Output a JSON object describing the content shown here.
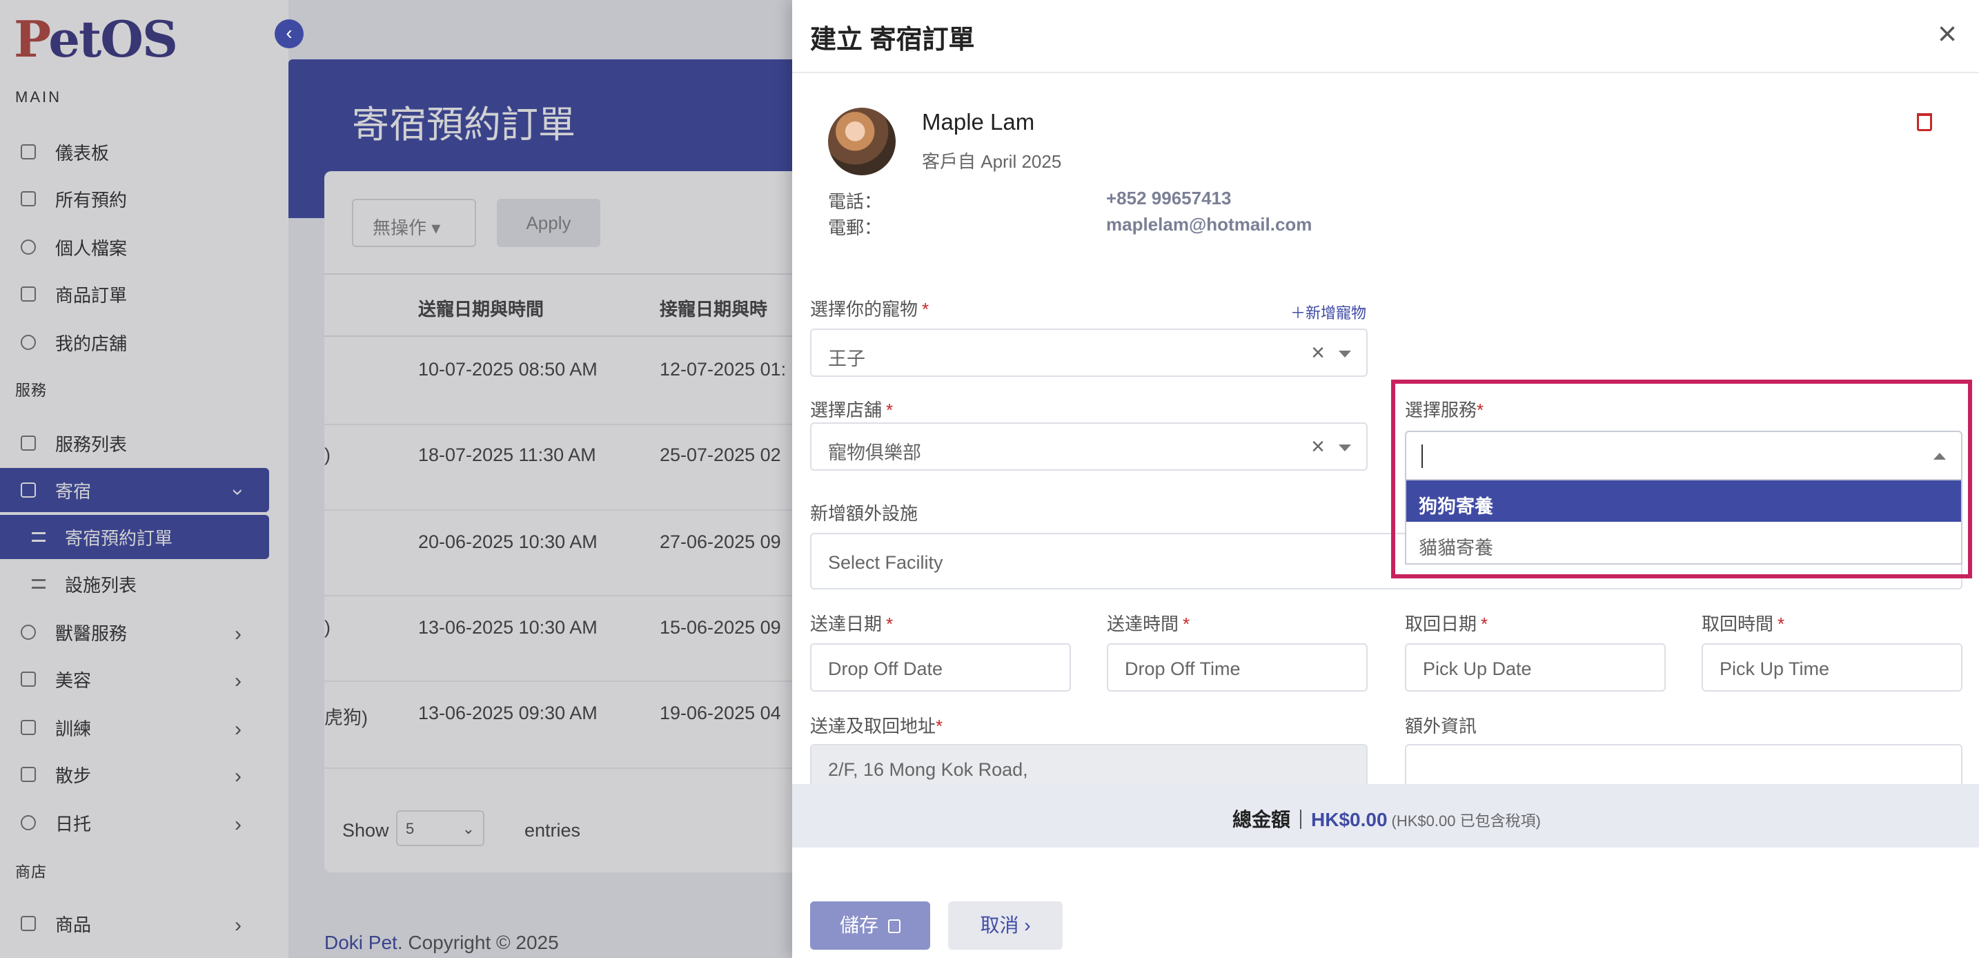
{
  "sidebar": {
    "logo": "PetOS",
    "sections": {
      "main": "MAIN",
      "services": "服務",
      "shop": "商店"
    },
    "items": [
      {
        "label": "儀表板"
      },
      {
        "label": "所有預約"
      },
      {
        "label": "個人檔案"
      },
      {
        "label": "商品訂單"
      },
      {
        "label": "我的店舖"
      },
      {
        "label": "服務列表"
      },
      {
        "label": "寄宿",
        "expanded": true
      },
      {
        "label": "寄宿預約訂單",
        "active": true
      },
      {
        "label": "設施列表"
      },
      {
        "label": "獸醫服務"
      },
      {
        "label": "美容"
      },
      {
        "label": "訓練"
      },
      {
        "label": "散步"
      },
      {
        "label": "日托"
      },
      {
        "label": "商品"
      }
    ]
  },
  "page": {
    "title": "寄宿預約訂單",
    "bulk_action": "無操作",
    "apply": "Apply",
    "columns": {
      "dropoff": "送寵日期與時間",
      "pickup": "接寵日期與時"
    },
    "rows": [
      {
        "prefix": "",
        "dropoff": "10-07-2025 08:50 AM",
        "pickup": "12-07-2025 01:"
      },
      {
        "prefix": ")",
        "dropoff": "18-07-2025 11:30 AM",
        "pickup": "25-07-2025 02"
      },
      {
        "prefix": "",
        "dropoff": "20-06-2025 10:30 AM",
        "pickup": "27-06-2025 09"
      },
      {
        "prefix": ")",
        "dropoff": "13-06-2025 10:30 AM",
        "pickup": "15-06-2025 09"
      },
      {
        "prefix": "虎狗)",
        "dropoff": "13-06-2025 09:30 AM",
        "pickup": "19-06-2025 04"
      }
    ],
    "show": "Show",
    "page_size": "5",
    "entries": "entries",
    "footer_brand": "Doki Pet",
    "footer_rest": ". Copyright © 2025"
  },
  "drawer": {
    "title": "建立 寄宿訂單",
    "customer": {
      "name": "Maple Lam",
      "since": "客戶自 April 2025",
      "phone_label": "電話：",
      "phone": "+852 99657413",
      "email_label": "電郵：",
      "email": "maplelam@hotmail.com"
    },
    "form": {
      "pet_label": "選擇你的寵物",
      "add_pet": "＋新增寵物",
      "pet_value": "王子",
      "store_label": "選擇店舖",
      "store_value": "寵物俱樂部",
      "service_label": "選擇服務",
      "service_options": [
        "狗狗寄養",
        "貓貓寄養"
      ],
      "facility_label": "新增額外設施",
      "facility_placeholder": "Select Facility",
      "dropoff_date_label": "送達日期",
      "dropoff_date_placeholder": "Drop Off Date",
      "dropoff_time_label": "送達時間",
      "dropoff_time_placeholder": "Drop Off Time",
      "pickup_date_label": "取回日期",
      "pickup_date_placeholder": "Pick Up Date",
      "pickup_time_label": "取回時間",
      "pickup_time_placeholder": "Pick Up Time",
      "address_label": "送達及取回地址",
      "address_value": "2/F, 16 Mong Kok Road,",
      "extra_label": "額外資訊",
      "required_mark": "*"
    },
    "total": {
      "label": "總金額",
      "amount": "HK$0.00",
      "tax_note": "(HK$0.00 已包含稅項)"
    },
    "save": "儲存",
    "cancel": "取消"
  },
  "colors": {
    "primary": "#3f4ba3",
    "highlight": "#c7225d",
    "danger": "#c62828"
  }
}
